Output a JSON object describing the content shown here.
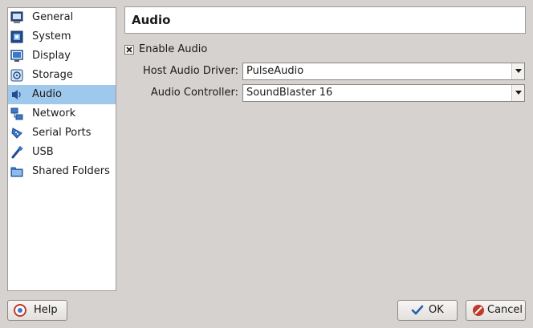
{
  "sidebar": {
    "items": [
      {
        "label": "General",
        "icon": "general-icon"
      },
      {
        "label": "System",
        "icon": "system-icon"
      },
      {
        "label": "Display",
        "icon": "display-icon"
      },
      {
        "label": "Storage",
        "icon": "storage-icon"
      },
      {
        "label": "Audio",
        "icon": "audio-icon",
        "selected": true
      },
      {
        "label": "Network",
        "icon": "network-icon"
      },
      {
        "label": "Serial Ports",
        "icon": "serial-ports-icon"
      },
      {
        "label": "USB",
        "icon": "usb-icon"
      },
      {
        "label": "Shared Folders",
        "icon": "shared-folders-icon"
      }
    ]
  },
  "page": {
    "title": "Audio"
  },
  "audio": {
    "enable_label": "Enable Audio",
    "enabled": true,
    "host_driver_label": "Host Audio Driver:",
    "host_driver_value": "PulseAudio",
    "controller_label": "Audio Controller:",
    "controller_value": "SoundBlaster 16"
  },
  "buttons": {
    "help": "Help",
    "ok": "OK",
    "cancel": "Cancel"
  },
  "colors": {
    "background": "#d6d2d0",
    "selection": "#9ec8ec"
  }
}
